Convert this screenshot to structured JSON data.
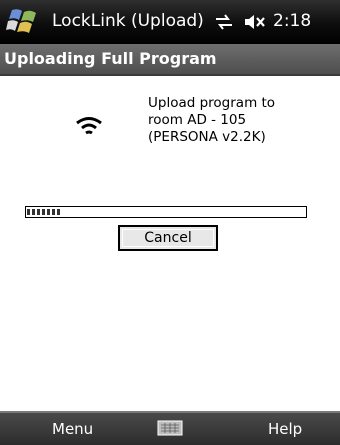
{
  "titlebar": {
    "title": "LockLink (Upload)",
    "time": "2:18",
    "icons": [
      "start-logo-icon",
      "connectivity-icon",
      "volume-muted-icon"
    ]
  },
  "header": {
    "title": "Uploading Full Program"
  },
  "main": {
    "icon": "wireless-signal-icon",
    "message_lines": [
      "Upload program to",
      "room AD - 105",
      "(PERSONA v2.2K)"
    ],
    "progress_fraction": 0.12,
    "cancel_label": "Cancel"
  },
  "menubar": {
    "left_label": "Menu",
    "right_label": "Help",
    "center_icon": "keyboard-icon"
  }
}
